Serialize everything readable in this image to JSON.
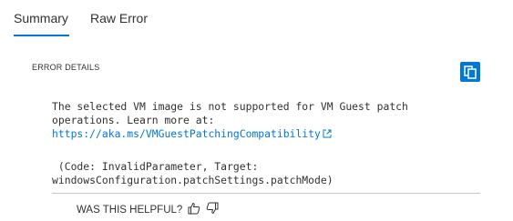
{
  "tabs": {
    "summary_label": "Summary",
    "raw_error_label": "Raw Error"
  },
  "section": {
    "title": "ERROR DETAILS"
  },
  "error": {
    "line1": "The selected VM image is not supported for VM Guest patch",
    "line2": "operations. Learn more at:",
    "link_text": "https://aka.ms/VMGuestPatchingCompatibility",
    "code_line1": " (Code: InvalidParameter, Target:",
    "code_line2": "windowsConfiguration.patchSettings.patchMode)"
  },
  "feedback": {
    "question": "WAS THIS HELPFUL?"
  },
  "icons": {
    "copy": "copy-icon",
    "external_link": "external-link-icon",
    "thumbs_up": "thumbs-up-icon",
    "thumbs_down": "thumbs-down-icon"
  },
  "colors": {
    "accent": "#0078d4",
    "text": "#323130",
    "divider": "#c8c6c4"
  }
}
